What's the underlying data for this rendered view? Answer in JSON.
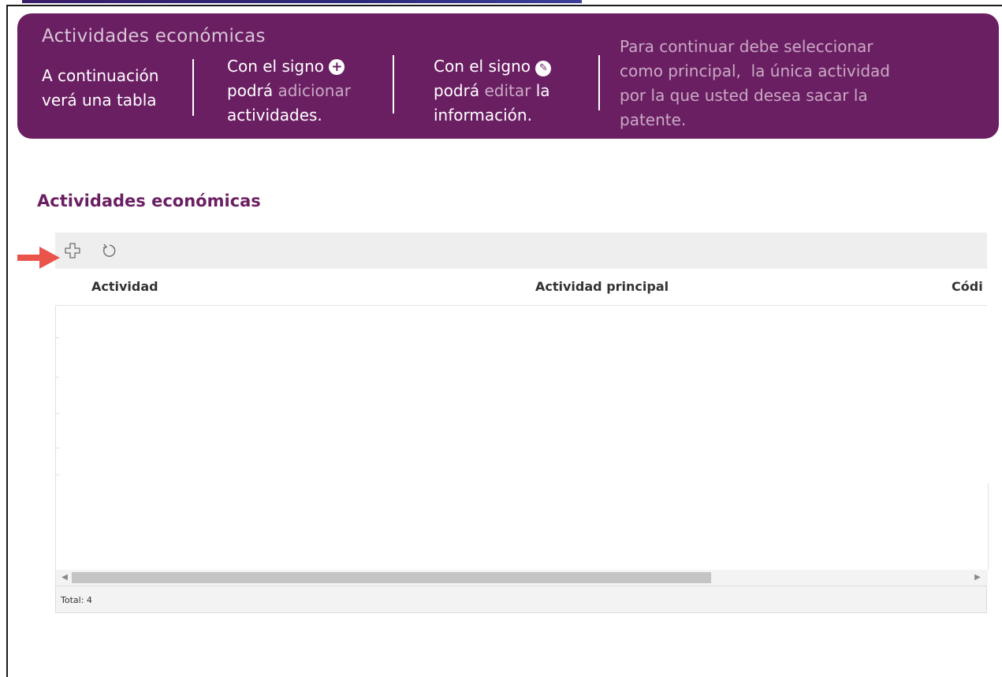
{
  "banner": {
    "title": "Actividades económicas",
    "col1": {
      "line1": "A continuación",
      "line2": "verá una tabla"
    },
    "col2": {
      "line1": "Con el signo",
      "line2_a": "podrá",
      "line2_b": "adicionar",
      "line3": "actividades."
    },
    "col3": {
      "line1": "Con el signo",
      "line2_a": "podrá",
      "line2_b": "editar",
      "line2_c": "la",
      "line3": "información."
    },
    "col4": {
      "line1": "Para continuar debe seleccionar",
      "line2": "como principal,  la única actividad",
      "line3": "por la que usted desea sacar la",
      "line4": "patente."
    },
    "icons": {
      "add": "plus-circle-icon",
      "edit": "pencil-circle-icon"
    }
  },
  "section": {
    "title": "Actividades económicas"
  },
  "toolbar": {
    "add_icon": "plus-icon",
    "refresh_icon": "refresh-icon"
  },
  "table": {
    "columns": [
      "Actividad",
      "Actividad principal",
      "Códi"
    ],
    "rows": []
  },
  "footer": {
    "total": "Total: 4"
  },
  "colors": {
    "banner": "#6b1f63",
    "accent_text": "#c9a9c4",
    "arrow": "#e8453c"
  }
}
